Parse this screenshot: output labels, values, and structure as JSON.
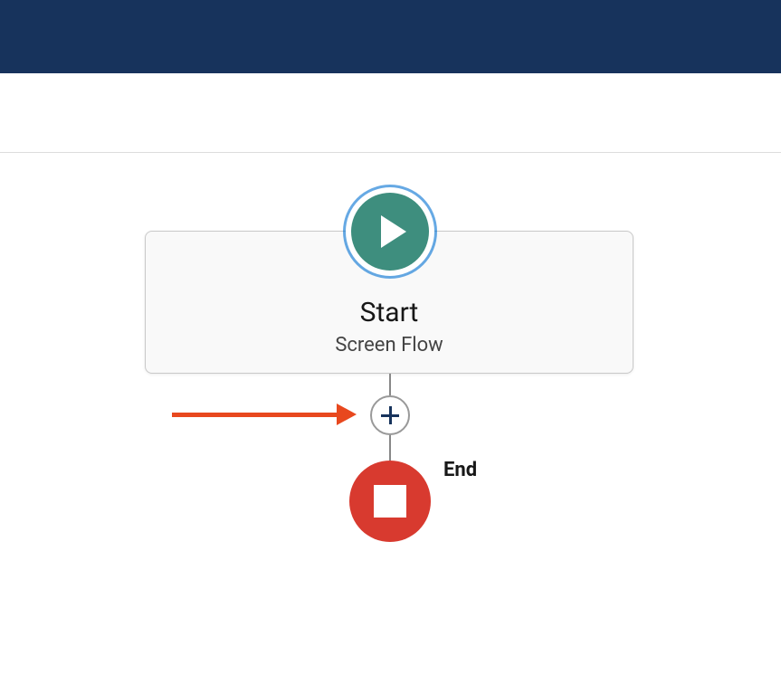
{
  "flow": {
    "start": {
      "title": "Start",
      "subtitle": "Screen Flow"
    },
    "end": {
      "label": "End"
    }
  },
  "colors": {
    "header_bg": "#17335c",
    "start_icon_bg": "#3e8e7e",
    "end_icon_bg": "#d83a2f",
    "annotation_arrow": "#e8481e"
  }
}
